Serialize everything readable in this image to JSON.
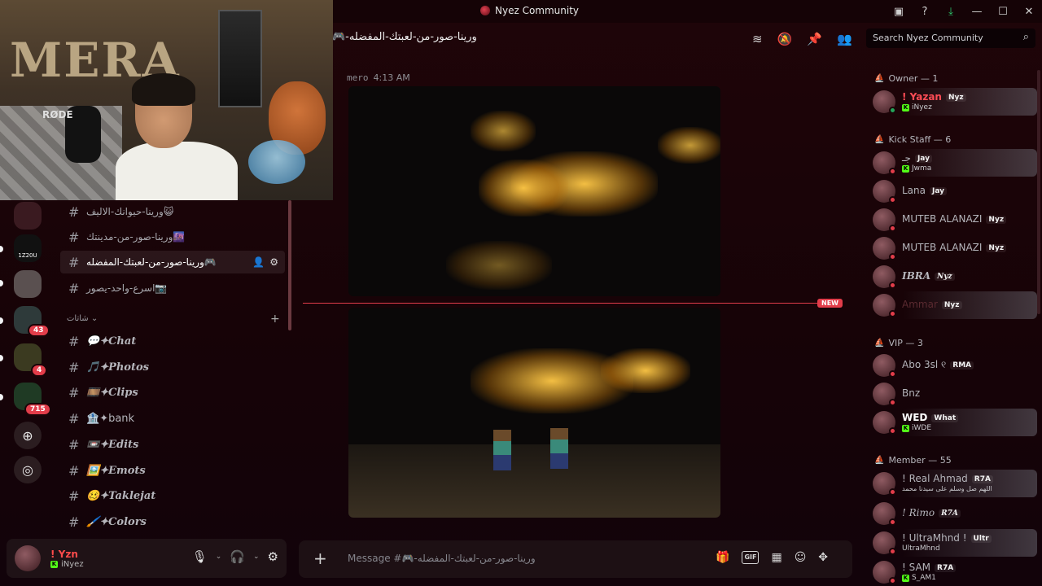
{
  "window": {
    "title": "Nyez Community"
  },
  "webcam": {
    "mic_brand": "RØDE",
    "balloon_text": "MERA"
  },
  "servers": [
    {
      "label": ""
    },
    {
      "label": "1Z20U"
    },
    {
      "label": ""
    },
    {
      "label": "",
      "badge": "43"
    },
    {
      "label": "",
      "badge": "4"
    },
    {
      "label": "",
      "badge": "715"
    }
  ],
  "channels": [
    {
      "emoji": "😺",
      "name": "ورينا-حيوانك-الاليف"
    },
    {
      "emoji": "🌆",
      "name": "ورينا-صور-من-مدينتك"
    },
    {
      "emoji": "🎮",
      "name": "ورينا-صور-من-لعبتك-المفضله",
      "active": true
    },
    {
      "emoji": "📷",
      "name": "اسرع-واحد-يصور"
    }
  ],
  "category": {
    "name": "شاتات"
  },
  "text_channels": [
    {
      "emoji": "💬",
      "name": "✦Chat"
    },
    {
      "emoji": "🎵",
      "name": "✦Photos"
    },
    {
      "emoji": "🎞️",
      "name": "✦Clips"
    },
    {
      "emoji": "🏦",
      "name": "✦bank"
    },
    {
      "emoji": "📼",
      "name": "✦Edits"
    },
    {
      "emoji": "🖼️",
      "name": "✦Emots"
    },
    {
      "emoji": "🥴",
      "name": "✦Taklejat"
    },
    {
      "emoji": "🖌️",
      "name": "✦Colors"
    }
  ],
  "user": {
    "display_name": "! Yzn",
    "status": "iNyez"
  },
  "chat": {
    "title": "ورينا-صور-من-لعبتك-المفضله-🎮",
    "message_author": "mero",
    "message_time": "4:13 AM",
    "new_label": "NEW",
    "composer_placeholder": "Message #🎮-ورينا-صور-من-لعبتك-المفضله"
  },
  "search": {
    "placeholder": "Search Nyez Community"
  },
  "member_groups": {
    "owner": "Owner — 1",
    "staff": "Kick Staff — 6",
    "vip": "VIP — 3",
    "member": "Member — 55"
  },
  "members": {
    "owner": [
      {
        "name": "! Yazan",
        "tag": "Nyz",
        "sub": "iNyez",
        "status": "online"
      }
    ],
    "staff": [
      {
        "name": "جـ",
        "tag": "Jay",
        "sub": "Jwma",
        "status": "dnd"
      },
      {
        "name": "Lana",
        "tag": "Jay",
        "status": "dnd"
      },
      {
        "name": "MUTEB ALANAZI",
        "tag": "Nyz",
        "status": "dnd"
      },
      {
        "name": "MUTEB ALANAZI",
        "tag": "Nyz",
        "status": "dnd"
      },
      {
        "name": "IBRA",
        "tag": "Nyz",
        "status": "dnd"
      },
      {
        "name": "Ammar",
        "tag": "Nyz",
        "status": "dnd"
      }
    ],
    "vip": [
      {
        "name": "Abo 3sl ୧",
        "tag": "RMA",
        "status": "dnd"
      },
      {
        "name": "Bnz",
        "status": "dnd"
      },
      {
        "name": "WED",
        "tag": "What",
        "sub": "iWDE",
        "status": "dnd"
      }
    ],
    "member": [
      {
        "name": "! Real Ahmad",
        "tag": "R7A",
        "sub": "اللهم صل وسلم على سيدنا محمد",
        "status": "dnd"
      },
      {
        "name": "! Rimo",
        "tag": "R7A",
        "status": "dnd"
      },
      {
        "name": "! UltraMhnd !",
        "tag": "Ultr",
        "sub": "UltraMhnd",
        "status": "dnd"
      },
      {
        "name": "! SAM",
        "tag": "R7A",
        "sub": "S_AM1",
        "status": "dnd"
      }
    ]
  }
}
